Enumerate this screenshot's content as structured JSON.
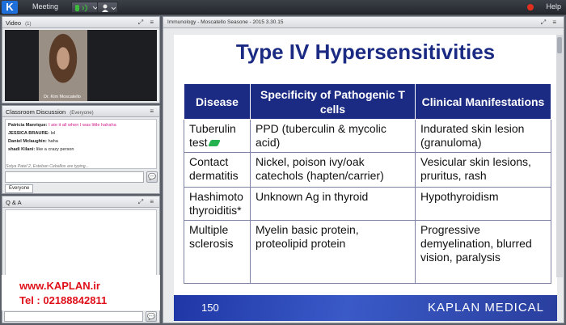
{
  "topbar": {
    "logo_text": "K",
    "meeting_label": "Meeting",
    "help_label": "Help"
  },
  "video_panel": {
    "title": "Video",
    "count": "(1)",
    "presenter_name": "Dr. Kim Moscatello"
  },
  "chat_panel": {
    "title": "Classroom Discussion",
    "audience": "(Everyone)",
    "messages": [
      {
        "sender": "Patricia Manrique:",
        "text": "I ate it all when I was little hahaha",
        "highlight": true
      },
      {
        "sender": "JESSICA BRAURE:",
        "text": "lol",
        "highlight": false
      },
      {
        "sender": "Daniel Mclaughin:",
        "text": "haha",
        "highlight": false
      },
      {
        "sender": "shadi Kilani:",
        "text": "like a crazy person",
        "highlight": false
      }
    ],
    "typing_status": "Sotya Patel 2, Esteban Ceballos are typing...",
    "tab_label": "Everyone"
  },
  "qa_panel": {
    "title": "Q & A"
  },
  "watermark": {
    "url": "www.KAPLAN.ir",
    "tel": "Tel : 02188842811"
  },
  "presentation": {
    "header": "Immunology - Moscatello Seasone - 2015 3.30.15",
    "slide": {
      "title": "Type IV Hypersensitivities",
      "headers": [
        "Disease",
        "Specificity of Pathogenic T cells",
        "Clinical Manifestations"
      ],
      "rows": [
        [
          "Tuberulin test",
          "PPD (tuberculin & mycolic acid)",
          "Indurated skin lesion (granuloma)"
        ],
        [
          "Contact dermatitis",
          "Nickel, poison ivy/oak catechols (hapten/carrier)",
          "Vesicular skin lesions, pruritus, rash"
        ],
        [
          "Hashimoto thyroiditis*",
          "Unknown Ag in thyroid",
          "Hypothyroidism"
        ],
        [
          "Multiple sclerosis",
          "Myelin basic protein, proteolipid protein",
          "Progressive demyelination, blurred vision, paralysis"
        ]
      ],
      "page_number": "150",
      "brand": "KAPLAN MEDICAL"
    }
  },
  "colors": {
    "slide_title": "#1b2a82",
    "table_header": "#1b2a82",
    "watermark": "#e0101a",
    "chat_highlight": "#d01c8b"
  }
}
